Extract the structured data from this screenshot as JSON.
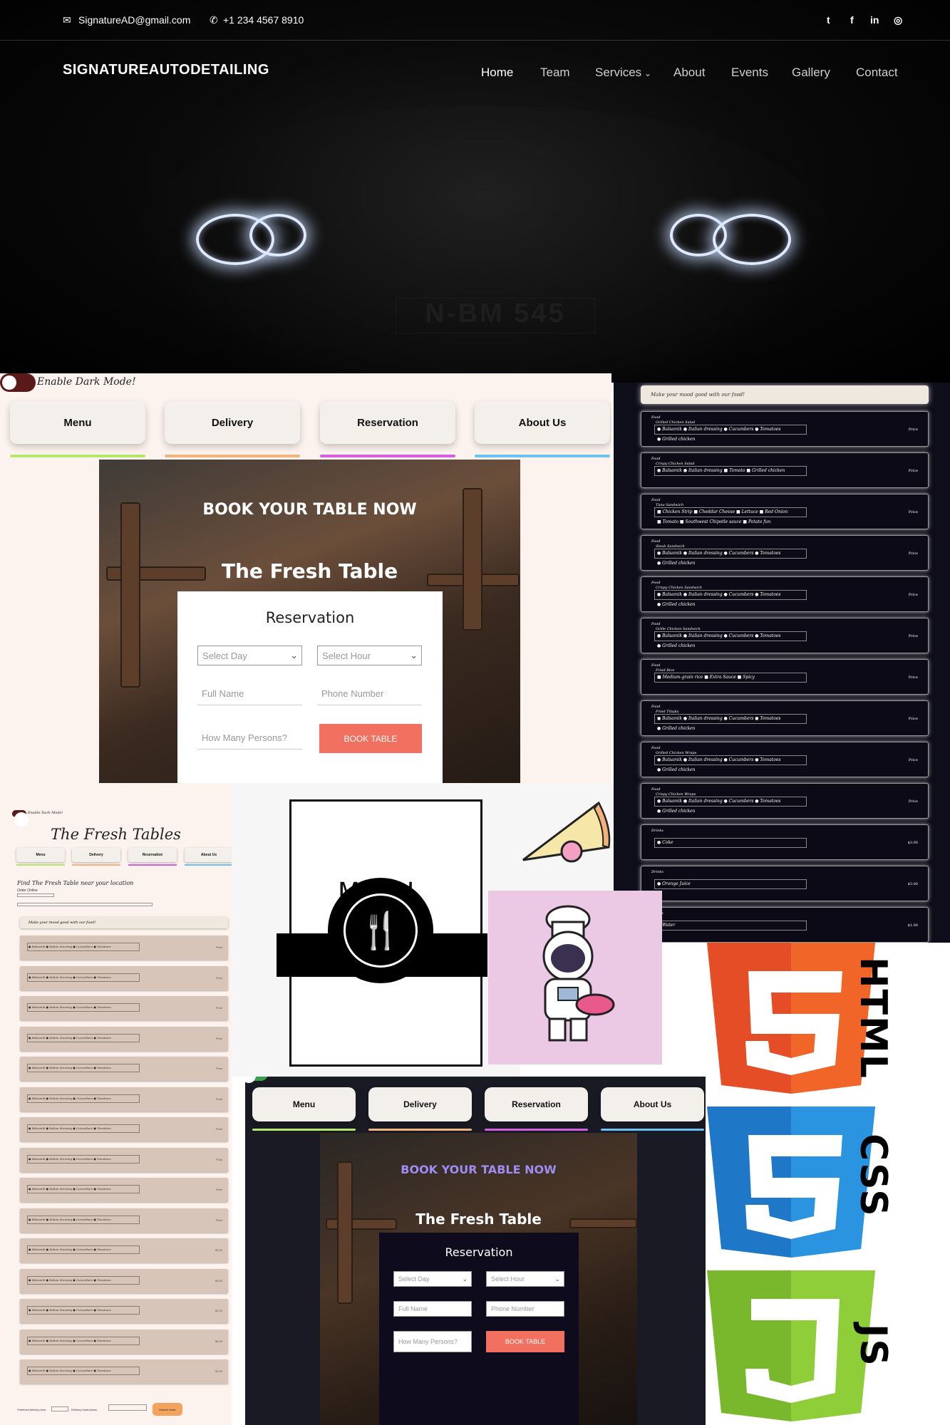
{
  "detailing": {
    "email": "SignatureAD@gmail.com",
    "phone": "+1 234 4567 8910",
    "brand": "SIGNATUREAUTODETAILING",
    "nav": [
      "Home",
      "Team",
      "Services",
      "About",
      "Events",
      "Gallery",
      "Contact"
    ],
    "plate": "N-BM 545",
    "social_icons": [
      "twitter-icon",
      "facebook-icon",
      "linkedin-icon",
      "instagram-icon"
    ]
  },
  "fresh_light": {
    "dark_mode_label": "Enable Dark Mode!",
    "tabs": [
      "Menu",
      "Delivery",
      "Reservation",
      "About Us"
    ],
    "tab_colors": [
      "#b5e86a",
      "#f2b47e",
      "#d65fe0",
      "#6cc2f0"
    ],
    "book_heading": "BOOK YOUR TABLE NOW",
    "restaurant": "The Fresh Table",
    "reservation_title": "Reservation",
    "select_day": "Select Day",
    "select_hour": "Select Hour",
    "full_name": "Full Name",
    "phone_number": "Phone Number",
    "persons": "How Many Persons?",
    "book_button": "BOOK TABLE",
    "accent": "#f1705f"
  },
  "dark_menu": {
    "tagline": "Make your mood good with our food!",
    "items": [
      {
        "cat": "Food",
        "name": "Grilled Chicken Salad",
        "opts": "● Balsamik ● Italian dressing ● Cucumbers ● Tomatoes",
        "opts2": "● Grilled chicken",
        "price": "Price"
      },
      {
        "cat": "Food",
        "name": "Crispy Chicken Salad",
        "opts": "● Balsamik ● Italian dressing ■ Tomato ■ Grilled chicken",
        "opts2": "",
        "price": "Price"
      },
      {
        "cat": "Food",
        "name": "Tuna Sandwich",
        "opts": "■ Chicken Strip ■ Cheddar Cheese ■ Lettuce ■ Red Onion",
        "opts2": "■ Tomato ■ Southwest Chipotle sauce ■ Potato fun",
        "price": "Price"
      },
      {
        "cat": "Food",
        "name": "Steak Sandwich",
        "opts": "● Balsamik ● Italian dressing ● Cucumbers ● Tomatoes",
        "opts2": "● Grilled chicken",
        "price": "Price"
      },
      {
        "cat": "Food",
        "name": "Crispy Chicken Sandwich",
        "opts": "● Balsamik ● Italian dressing ● Cucumbers ● Tomatoes",
        "opts2": "● Grilled chicken",
        "price": "Price"
      },
      {
        "cat": "Food",
        "name": "Grille Chicken Sandwich",
        "opts": "● Balsamik ● Italian dressing ● Cucumbers ● Tomatoes",
        "opts2": "● Grilled chicken",
        "price": "Price"
      },
      {
        "cat": "Food",
        "name": "Fried Rice",
        "opts": "■ Medium-grain rice ■ Extra Sauce ■ Spicy",
        "opts2": "",
        "price": "Price"
      },
      {
        "cat": "Food",
        "name": "Fried Tilapia",
        "opts": "● Balsamik ● Italian dressing ● Cucumbers ● Tomatoes",
        "opts2": "● Grilled chicken",
        "price": "Price"
      },
      {
        "cat": "Food",
        "name": "Grilled Chicken Wraps",
        "opts": "● Balsamik ● Italian dressing ● Cucumbers ● Tomatoes",
        "opts2": "● Grilled chicken",
        "price": "Price"
      },
      {
        "cat": "Food",
        "name": "Crispy Chicken Wraps",
        "opts": "● Balsamik ● Italian dressing ● Cucumbers ● Tomatoes",
        "opts2": "● Grilled chicken",
        "price": "Price"
      },
      {
        "cat": "Drinks",
        "name": "",
        "opts": "● Coke",
        "opts2": "",
        "price": "$3.00"
      },
      {
        "cat": "Drinks",
        "name": "",
        "opts": "● Orange Juice",
        "opts2": "",
        "price": "$3.00"
      },
      {
        "cat": "Drinks",
        "name": "",
        "opts": "● Water",
        "opts2": "",
        "price": "$1.00"
      }
    ]
  },
  "fresh_small": {
    "dark_mode_label": "Enable Dark Mode!",
    "title": "The Fresh Tables",
    "tabs": [
      "Menu",
      "Delivery",
      "Reservation",
      "About Us"
    ],
    "find_text": "Find The Fresh Table near your location",
    "order_online": "Order Online",
    "tagline": "Make your mood good with our food!",
    "submit": "Submit Order",
    "delivery_label": "Preferred delivery time:",
    "delivery_instructions": "Delivery Instructions",
    "card_opts": "● Balsamik ● Italian dressing ● Cucumbers ● Tomatoes",
    "card_prices": [
      "Price",
      "Price",
      "Price",
      "Price",
      "Price",
      "Price",
      "Price",
      "Price",
      "Price",
      "Price",
      "$3.00",
      "$3.00",
      "$1.00",
      "$8.99",
      "$3.99"
    ]
  },
  "menu_graphic": {
    "title": "MENU"
  },
  "tech": {
    "labels": [
      "HTML",
      "CSS",
      "JS"
    ],
    "colors": [
      "#e44d26",
      "#1f77c7",
      "#79b82c"
    ]
  },
  "fresh_dark": {
    "tabs": [
      "Menu",
      "Delivery",
      "Reservation",
      "About Us"
    ],
    "book_heading": "BOOK YOUR TABLE NOW",
    "restaurant": "The Fresh Table",
    "reservation_title": "Reservation",
    "select_day": "Select Day",
    "select_hour": "Select Hour",
    "full_name": "Full Name",
    "phone_number": "Phone Number",
    "persons": "How Many Persons?",
    "book_button": "BOOK TABLE",
    "heading_color": "#9f8cf5"
  }
}
